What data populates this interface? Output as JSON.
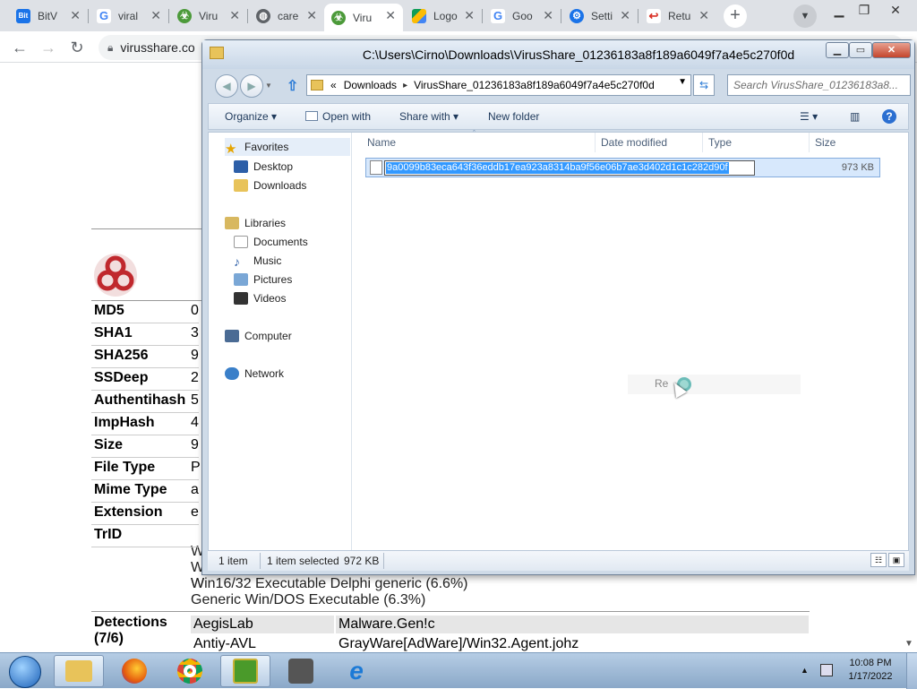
{
  "browser": {
    "tabs": [
      {
        "title": "BitV",
        "icon": "bitview-icon",
        "active": false
      },
      {
        "title": "viral",
        "icon": "google-icon",
        "active": false
      },
      {
        "title": "Viru",
        "icon": "virusshare-icon",
        "active": false
      },
      {
        "title": "care",
        "icon": "globe-icon",
        "active": false
      },
      {
        "title": "Viru",
        "icon": "virusshare-icon",
        "active": true
      },
      {
        "title": "Logo",
        "icon": "drive-icon",
        "active": false
      },
      {
        "title": "Goo",
        "icon": "google-icon",
        "active": false
      },
      {
        "title": "Setti",
        "icon": "settings-icon",
        "active": false
      },
      {
        "title": "Retu",
        "icon": "return-icon",
        "active": false
      }
    ],
    "address": "virusshare.co"
  },
  "webpage": {
    "fields": [
      {
        "label": "MD5",
        "value": "0"
      },
      {
        "label": "SHA1",
        "value": "3"
      },
      {
        "label": "SHA256",
        "value": "9"
      },
      {
        "label": "SSDeep",
        "value": "2"
      },
      {
        "label": "Authentihash",
        "value": "5"
      },
      {
        "label": "ImpHash",
        "value": "4"
      },
      {
        "label": "Size",
        "value": "9"
      },
      {
        "label": "File Type",
        "value": "P"
      },
      {
        "label": "Mime Type",
        "value": "a"
      },
      {
        "label": "Extension",
        "value": "e"
      },
      {
        "label": "TrID",
        "value": ""
      }
    ],
    "trid_lines": [
      "W",
      "W",
      "W",
      "Win16/32 Executable Delphi generic (6.6%)",
      "Generic Win/DOS Executable (6.3%)"
    ],
    "detections_label": "Detections",
    "detections_count": "(7/6)",
    "detections": [
      {
        "av": "AegisLab",
        "result": "Malware.Gen!c"
      },
      {
        "av": "Antiy-AVL",
        "result": "GrayWare[AdWare]/Win32.Agent.johz"
      }
    ]
  },
  "explorer": {
    "title": "C:\\Users\\Cirno\\Downloads\\VirusShare_01236183a8f189a6049f7a4e5c270f0d",
    "breadcrumb": [
      "«",
      "Downloads",
      "VirusShare_01236183a8f189a6049f7a4e5c270f0d"
    ],
    "search_placeholder": "Search VirusShare_01236183a8...",
    "commands": [
      "Organize",
      "Open with",
      "Share with",
      "New folder"
    ],
    "nav": {
      "favorites": "Favorites",
      "desktop": "Desktop",
      "downloads": "Downloads",
      "libraries": "Libraries",
      "documents": "Documents",
      "music": "Music",
      "pictures": "Pictures",
      "videos": "Videos",
      "computer": "Computer",
      "network": "Network"
    },
    "columns": [
      "Name",
      "Date modified",
      "Type",
      "Size"
    ],
    "file": {
      "rename_value": "9a0099b83eca643f36eddb17ea923a8314ba9f56e06b7ae3d402d1c1c282d90f",
      "size": "973 KB"
    },
    "ghost_text": "Re",
    "status": {
      "count": "1 item",
      "selected": "1 item selected",
      "selected_size": "972 KB"
    }
  },
  "taskbar": {
    "apps": [
      "explorer-icon",
      "firefox-icon",
      "chrome-icon",
      "archive-icon",
      "media-icon",
      "ie-icon"
    ],
    "time": "10:08 PM",
    "date": "1/17/2022"
  }
}
